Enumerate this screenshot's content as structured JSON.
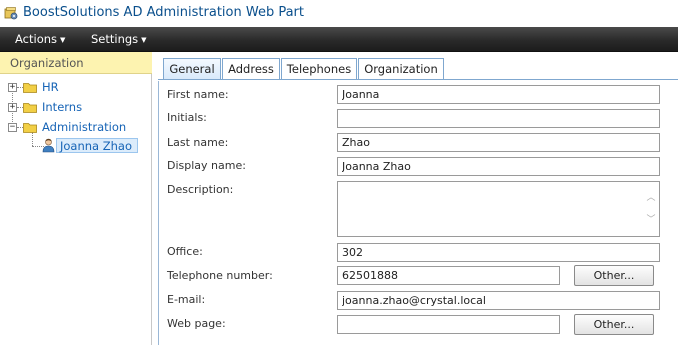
{
  "window": {
    "title": "BoostSolutions AD Administration Web Part"
  },
  "menubar": {
    "actions_label": "Actions",
    "settings_label": "Settings"
  },
  "sidebar": {
    "header": "Organization",
    "tree": [
      {
        "label": "HR",
        "expanded": false
      },
      {
        "label": "Interns",
        "expanded": false
      },
      {
        "label": "Administration",
        "expanded": true
      }
    ],
    "selected_user": "Joanna Zhao"
  },
  "tabs": [
    {
      "label": "General",
      "active": true
    },
    {
      "label": "Address",
      "active": false
    },
    {
      "label": "Telephones",
      "active": false
    },
    {
      "label": "Organization",
      "active": false
    }
  ],
  "form": {
    "first_name": {
      "label": "First name:",
      "value": "Joanna"
    },
    "initials": {
      "label": "Initials:",
      "value": ""
    },
    "last_name": {
      "label": "Last name:",
      "value": "Zhao"
    },
    "display_name": {
      "label": "Display name:",
      "value": "Joanna Zhao"
    },
    "description": {
      "label": "Description:",
      "value": ""
    },
    "office": {
      "label": "Office:",
      "value": "302"
    },
    "telephone": {
      "label": "Telephone number:",
      "value": "62501888",
      "other_label": "Other..."
    },
    "email": {
      "label": "E-mail:",
      "value": "joanna.zhao@crystal.local"
    },
    "web_page": {
      "label": "Web page:",
      "value": "",
      "other_label": "Other..."
    }
  },
  "colors": {
    "accent": "#1764b6",
    "header_yellow": "#fdf3b0",
    "menubar_dark": "#2a2a2a",
    "tab_border": "#7fa7cf"
  },
  "icons": {
    "title": "app-settings-icon",
    "folder": "folder-icon",
    "user": "user-icon"
  }
}
